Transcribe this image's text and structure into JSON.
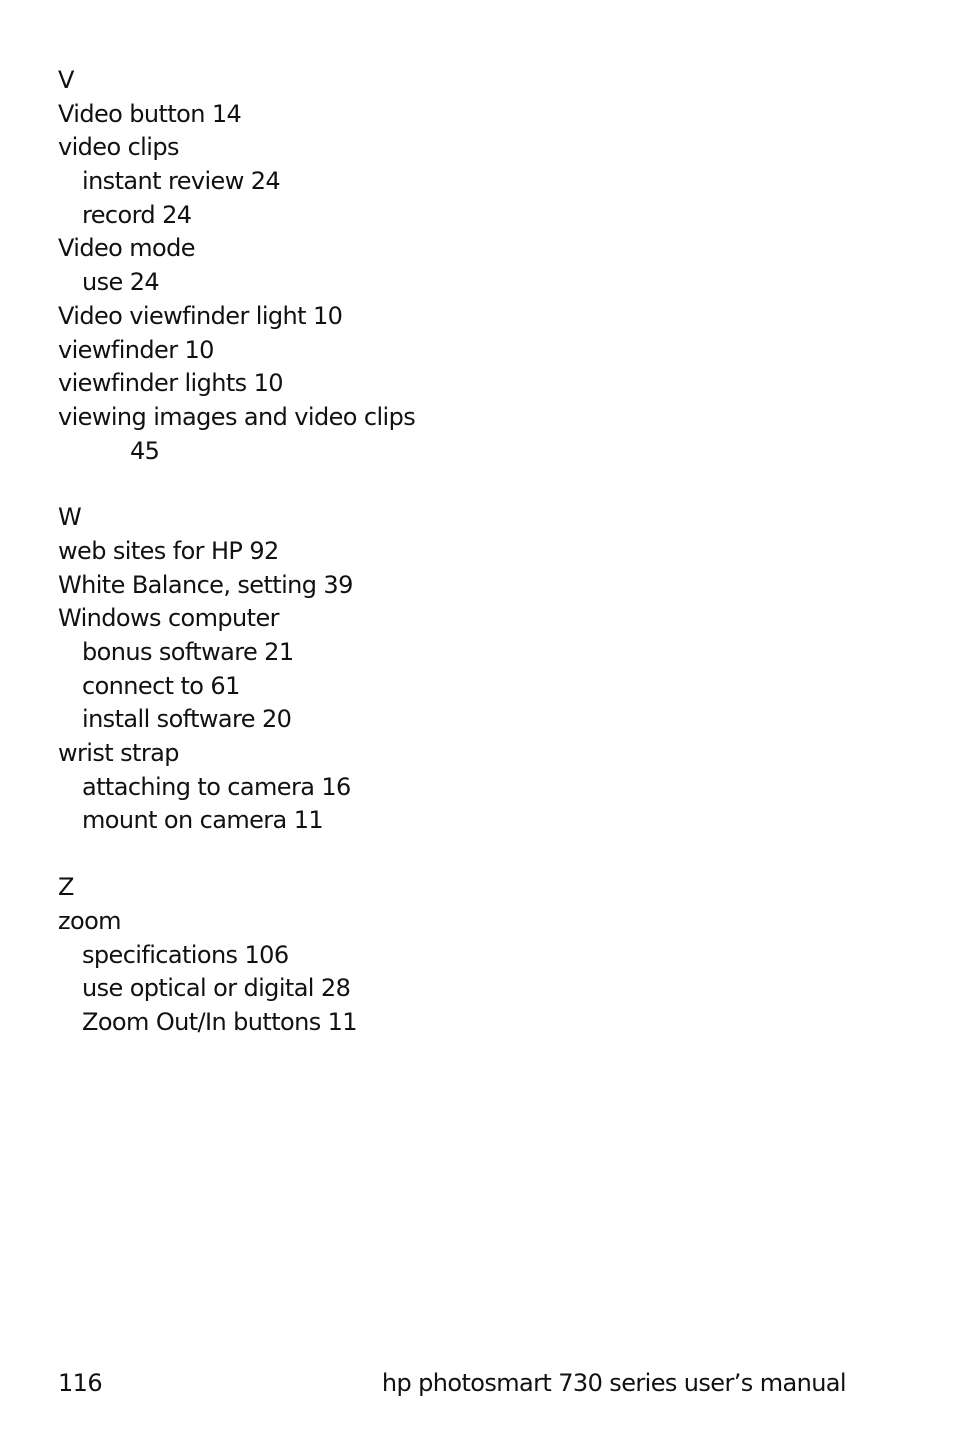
{
  "sections": [
    {
      "letter": "V",
      "lines": [
        {
          "level": "entry",
          "text": "Video button 14"
        },
        {
          "level": "entry",
          "text": "video clips"
        },
        {
          "level": "sub",
          "text": "instant review 24"
        },
        {
          "level": "sub",
          "text": "record 24"
        },
        {
          "level": "entry",
          "text": "Video mode"
        },
        {
          "level": "sub",
          "text": "use 24"
        },
        {
          "level": "entry",
          "text": "Video viewfinder light 10"
        },
        {
          "level": "entry",
          "text": "viewfinder 10"
        },
        {
          "level": "entry",
          "text": "viewfinder lights 10"
        },
        {
          "level": "entry",
          "text": "viewing images and video clips"
        },
        {
          "level": "cont",
          "text": "45"
        }
      ]
    },
    {
      "letter": "W",
      "lines": [
        {
          "level": "entry",
          "text": "web sites for HP 92"
        },
        {
          "level": "entry",
          "text": "White Balance, setting 39"
        },
        {
          "level": "entry",
          "text": "Windows computer"
        },
        {
          "level": "sub",
          "text": "bonus software 21"
        },
        {
          "level": "sub",
          "text": "connect to 61"
        },
        {
          "level": "sub",
          "text": "install software 20"
        },
        {
          "level": "entry",
          "text": "wrist strap"
        },
        {
          "level": "sub",
          "text": "attaching to camera 16"
        },
        {
          "level": "sub",
          "text": "mount on camera 11"
        }
      ]
    },
    {
      "letter": "Z",
      "lines": [
        {
          "level": "entry",
          "text": "zoom"
        },
        {
          "level": "sub",
          "text": "specifications 106"
        },
        {
          "level": "sub",
          "text": "use optical or digital 28"
        },
        {
          "level": "sub",
          "text": "Zoom Out/In buttons 11"
        }
      ]
    }
  ],
  "footer": {
    "page_number": "116",
    "manual_title": "hp photosmart 730 series user’s manual"
  }
}
